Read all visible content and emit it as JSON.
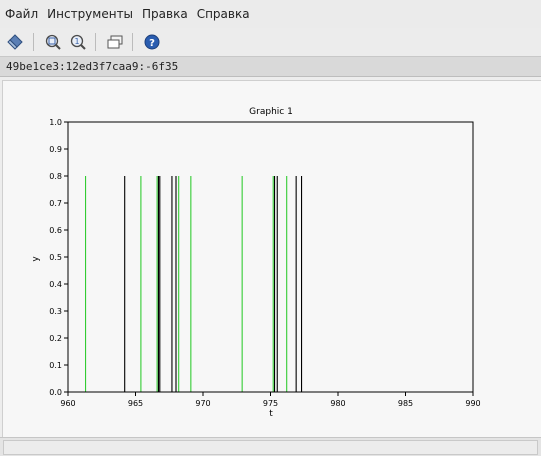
{
  "menubar": {
    "items": [
      {
        "label": "Файл"
      },
      {
        "label": "Инструменты"
      },
      {
        "label": "Правка"
      },
      {
        "label": "Справка"
      }
    ]
  },
  "toolbar": {
    "icons": [
      "datatip-icon",
      "zoom-icon",
      "zoom-reset-icon",
      "rotate-icon",
      "help-icon"
    ]
  },
  "figure_id": "49be1ce3:12ed3f7caa9:-6f35",
  "colors": {
    "series_black": "#000000",
    "series_green": "#33cc33",
    "accent_help": "#2a5db0"
  },
  "chart_data": {
    "type": "bar",
    "title": "Graphic 1",
    "xlabel": "t",
    "ylabel": "y",
    "xlim": [
      960,
      990
    ],
    "ylim": [
      0.0,
      1.0
    ],
    "xticks": [
      "960",
      "965",
      "970",
      "975",
      "980",
      "985",
      "990"
    ],
    "yticks": [
      "0.0",
      "0.1",
      "0.2",
      "0.3",
      "0.4",
      "0.5",
      "0.6",
      "0.7",
      "0.8",
      "0.9",
      "1.0"
    ],
    "grid": false,
    "series": [
      {
        "color": "black",
        "x": [
          964.2,
          966.7,
          966.8,
          967.7,
          968.0,
          975.3,
          975.5,
          976.9,
          977.3
        ],
        "y": 0.8
      },
      {
        "color": "green",
        "x": [
          961.3,
          965.4,
          966.6,
          968.2,
          969.1,
          972.9,
          975.2,
          976.2
        ],
        "y": 0.8
      }
    ]
  }
}
